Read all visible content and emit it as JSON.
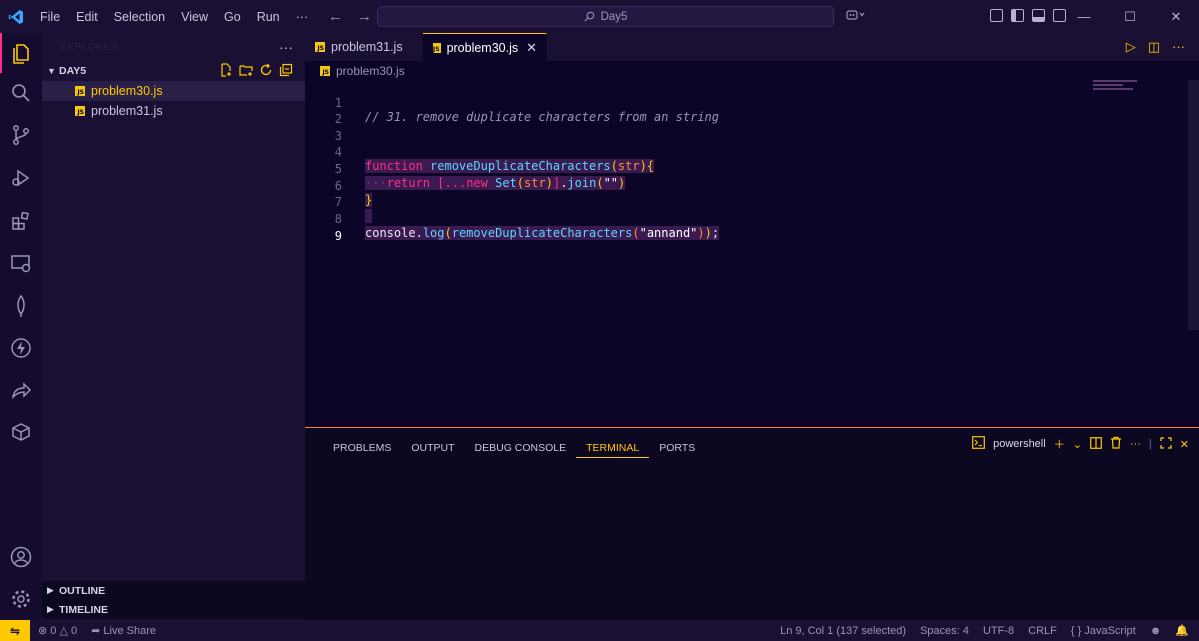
{
  "titlebar": {
    "menu": [
      "File",
      "Edit",
      "Selection",
      "View",
      "Go",
      "Run",
      "···"
    ],
    "search_text": "Day5",
    "back_arrow": "←",
    "forward_arrow": "→"
  },
  "activity_bar": {
    "icons": [
      "explorer-icon",
      "search-icon",
      "source-control-icon",
      "run-debug-icon",
      "extensions-icon",
      "remote-explorer-icon",
      "mongodb-icon",
      "thunder-client-icon",
      "live-share-icon",
      "docker-icon",
      "account-icon",
      "settings-gear-icon"
    ]
  },
  "sidebar": {
    "title": "EXPLORER",
    "more": "···",
    "folder": "DAY5",
    "files": [
      {
        "name": "problem30.js",
        "active": true
      },
      {
        "name": "problem31.js",
        "active": false
      }
    ],
    "outline": "OUTLINE",
    "timeline": "TIMELINE"
  },
  "tabs": [
    {
      "label": "problem31.js",
      "active": false
    },
    {
      "label": "problem30.js",
      "active": true,
      "close": "✕"
    }
  ],
  "breadcrumb": "problem30.js",
  "code": {
    "line_numbers": [
      "1",
      "2",
      "3",
      "4",
      "5",
      "6",
      "7",
      "8",
      "9"
    ],
    "comment": "// 31. remove duplicate characters from an string",
    "kw_function": "function",
    "fn_name": "removeDuplicateCharacters",
    "param": "str",
    "indent_dots": "···",
    "kw_return": "return",
    "spread": "[...",
    "kw_new": "new",
    "set": "Set",
    "join": "join",
    "empty_str": "\"\"",
    "console": "console",
    "log": "log",
    "arg_str": "\"annand\""
  },
  "panel": {
    "tabs": [
      "PROBLEMS",
      "OUTPUT",
      "DEBUG CONSOLE",
      "TERMINAL",
      "PORTS"
    ],
    "active_tab": "TERMINAL",
    "terminal_name": "powershell"
  },
  "status": {
    "errors": "0",
    "warnings": "0",
    "live_share": "Live Share",
    "position": "Ln 9, Col 1 (137 selected)",
    "spaces": "Spaces: 4",
    "encoding": "UTF-8",
    "eol": "CRLF",
    "language": "JavaScript"
  },
  "colors": {
    "accent": "#ffc800",
    "pink": "#ff2e88",
    "background": "#0b0628"
  }
}
